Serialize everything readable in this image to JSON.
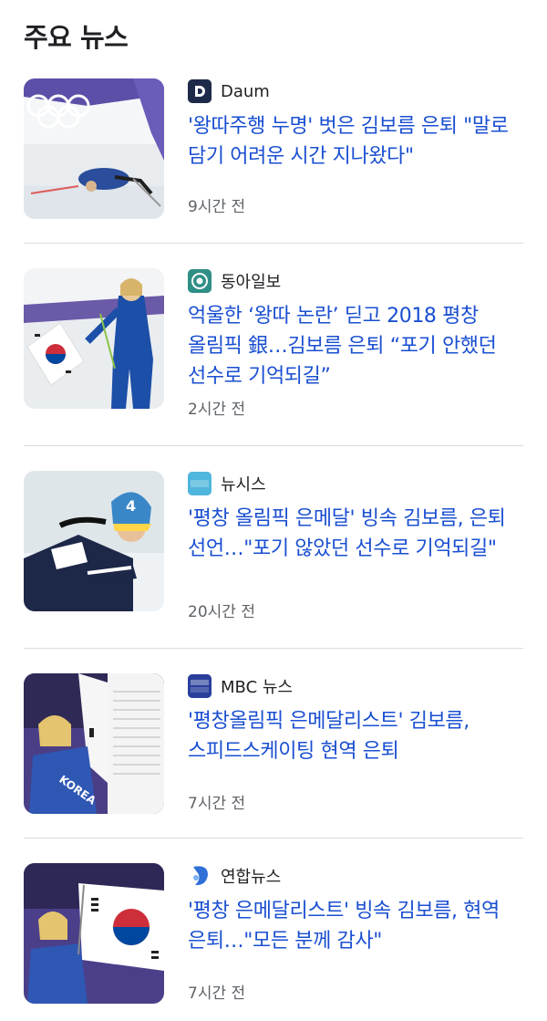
{
  "section_title": "주요 뉴스",
  "items": [
    {
      "source": "Daum",
      "logo_icon": "daum-logo-icon",
      "logo_color": "#1e2a4a",
      "headline": "'왕따주행 누명' 벗은 김보름 은퇴 \"말로 담기 어려운 시간 지나왔다\"",
      "time": "9시간 전"
    },
    {
      "source": "동아일보",
      "logo_icon": "donga-logo-icon",
      "logo_color": "#2f8f86",
      "headline": "억울한 ‘왕따 논란’ 딛고 2018 평창 올림픽 銀…김보름 은퇴 “포기 안했던 선수로 기억되길”",
      "time": "2시간 전"
    },
    {
      "source": "뉴시스",
      "logo_icon": "newsis-logo-icon",
      "logo_color": "#3aa7d6",
      "logo_text": "뉴시스",
      "headline": "'평창 올림픽 은메달' 빙속 김보름, 은퇴 선언…\"포기 않았던 선수로 기억되길\"",
      "time": "20시간 전"
    },
    {
      "source": "MBC 뉴스",
      "logo_icon": "mbc-news-logo-icon",
      "logo_color": "#2a3f9c",
      "logo_text": "MBC NEWS",
      "headline": "'평창올림픽 은메달리스트' 김보름, 스피드스케이팅 현역 은퇴",
      "time": "7시간 전"
    },
    {
      "source": "연합뉴스",
      "logo_icon": "yonhap-logo-icon",
      "logo_color": "#2f6fd6",
      "headline": "'평창 은메달리스트' 빙속 김보름, 현역 은퇴…\"모든 분께 감사\"",
      "time": "7시간 전"
    }
  ]
}
